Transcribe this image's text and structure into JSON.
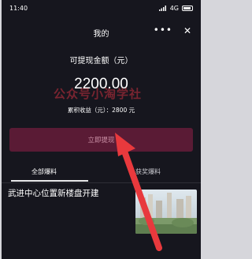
{
  "status_bar": {
    "time": "11:40",
    "network": "4G"
  },
  "header": {
    "title": "我的",
    "more_icon": "more-dots-icon",
    "close_icon": "close-icon"
  },
  "withdraw": {
    "label": "可提现金额（元）",
    "amount": "2200.00",
    "cumulative": "累积收益（元）：2800 元",
    "button_label": "立即提现"
  },
  "watermark": "公众号小淘学社",
  "tabs": [
    {
      "label": "全部爆料",
      "active": true
    },
    {
      "label": "获奖爆料",
      "active": false
    }
  ],
  "news": {
    "title": "武进中心位置新楼盘开建"
  },
  "colors": {
    "background": "#16161e",
    "button": "#5a1b35",
    "button_text": "#c98fa5",
    "arrow": "#e8393d"
  }
}
